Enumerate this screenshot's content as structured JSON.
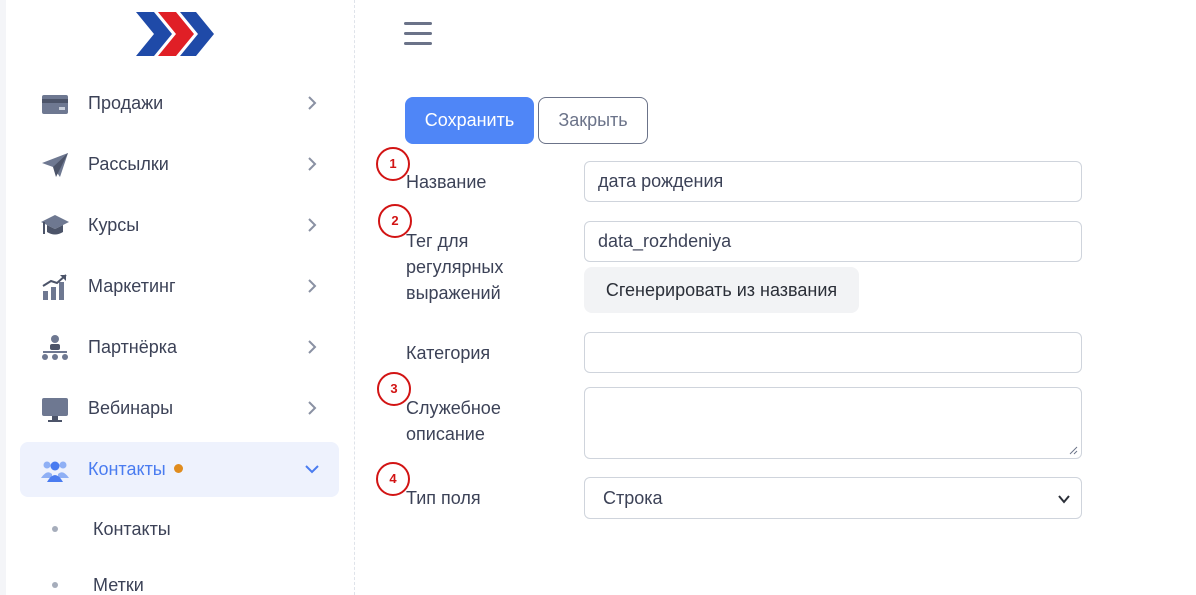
{
  "sidebar": {
    "logo_icon": "chevrons-logo",
    "items": [
      {
        "label": "Продажи",
        "icon": "card-icon"
      },
      {
        "label": "Рассылки",
        "icon": "paper-plane-icon"
      },
      {
        "label": "Курсы",
        "icon": "graduation-cap-icon"
      },
      {
        "label": "Маркетинг",
        "icon": "chart-growth-icon"
      },
      {
        "label": "Партнёрка",
        "icon": "hierarchy-icon"
      },
      {
        "label": "Вебинары",
        "icon": "monitor-icon"
      },
      {
        "label": "Контакты",
        "icon": "users-icon",
        "active": true,
        "has_dot": true
      }
    ],
    "sub_items": [
      {
        "label": "Контакты"
      },
      {
        "label": "Метки"
      }
    ]
  },
  "toolbar": {
    "menu_icon": "hamburger-icon",
    "save_label": "Сохранить",
    "close_label": "Закрыть"
  },
  "form": {
    "name_label": "Название",
    "name_value": "дата рождения",
    "tag_label_line1": "Тег для",
    "tag_label_line2": "регулярных",
    "tag_label_line3": "выражений",
    "tag_value": "data_rozhdeniya",
    "generate_label": "Сгенерировать из названия",
    "category_label": "Категория",
    "category_value": "",
    "description_label_line1": "Служебное",
    "description_label_line2": "описание",
    "description_value": "",
    "field_type_label": "Тип поля",
    "field_type_value": "Строка"
  },
  "annotations": [
    "1",
    "2",
    "3",
    "4"
  ],
  "colors": {
    "accent": "#4f86f7",
    "active_bg": "#eef2fd",
    "active_text": "#4a7cf0",
    "dot": "#e08c1e",
    "marker": "#d21414"
  }
}
